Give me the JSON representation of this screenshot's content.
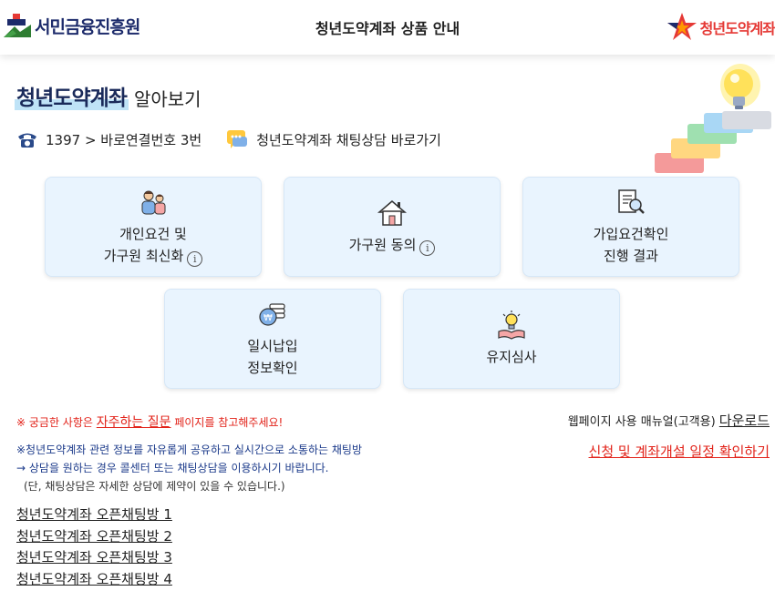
{
  "header": {
    "left_brand": "서민금융진흥원",
    "title": "청년도약계좌 상품 안내",
    "right_brand": "청년도약계좌"
  },
  "page": {
    "title_main": "청년도약계좌",
    "title_sub": "알아보기"
  },
  "contact": {
    "phone": "1397 > 바로연결번호 3번",
    "chat": "청년도약계좌 채팅상담 바로가기"
  },
  "cards": [
    {
      "line1": "개인요건 및",
      "line2": "가구원 최신화",
      "info": "i"
    },
    {
      "line1": "가구원 동의",
      "line2": "",
      "info": "i"
    },
    {
      "line1": "가입요건확인",
      "line2": "진행 결과"
    },
    {
      "line1": "일시납입",
      "line2": "정보확인"
    },
    {
      "line1": "유지심사",
      "line2": ""
    }
  ],
  "notes": {
    "faq_prefix": "※ 궁금한 사항은",
    "faq_link": "자주하는 질문",
    "faq_suffix": "페이지를 참고해주세요!",
    "manual_prefix": "웹페이지 사용 매뉴얼(고객용)",
    "manual_link": "다운로드",
    "schedule_link": "신청 및 계좌개설 일정 확인하기",
    "notice_line1": "※청년도약계좌 관련 정보를 자유롭게 공유하고 실시간으로 소통하는 채팅방",
    "notice_line2": "→ 상담을 원하는 경우 콜센터 또는 채팅상담을 이용하시기 바랍니다.",
    "notice_line3": "(단, 채팅상담은 자세한 상담에 제약이 있을 수 있습니다.)"
  },
  "open_chat_rooms": [
    "청년도약계좌 오픈채팅방 1",
    "청년도약계좌 오픈채팅방 2",
    "청년도약계좌 오픈채팅방 3",
    "청년도약계좌 오픈채팅방 4"
  ],
  "icons": {
    "left_logo": "kinfa-logo-icon",
    "right_logo": "star-logo-icon",
    "phone": "phone-icon",
    "chat": "chat-bubble-icon",
    "card1": "family-icon",
    "card2": "house-icon",
    "card3": "document-search-icon",
    "card4": "coin-stack-icon",
    "card5": "lightbulb-book-icon",
    "deco": "lightbulb-stairs-illustration"
  },
  "colors": {
    "navy": "#1a2a5a",
    "card_bg": "#e9f4fe",
    "red": "#e2231a",
    "highlight": "#bfe3f7"
  }
}
